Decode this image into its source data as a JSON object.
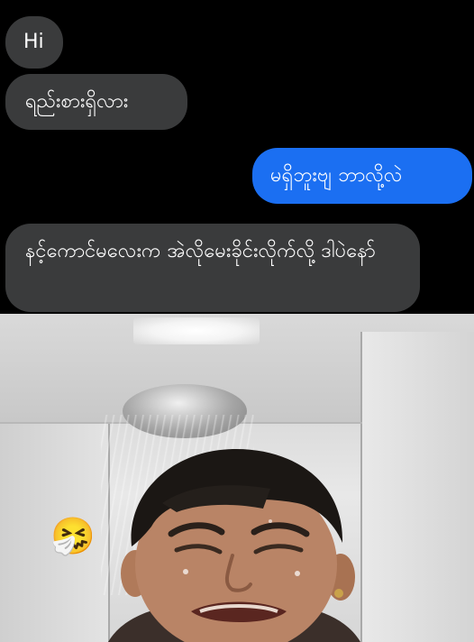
{
  "messages": [
    {
      "direction": "incoming",
      "text": "Hi"
    },
    {
      "direction": "incoming",
      "text": "ရည်းစားရှိလား"
    },
    {
      "direction": "outgoing",
      "text": "မရှိဘူးဗျ ဘာလို့လဲ"
    },
    {
      "direction": "incoming",
      "text": "နင့်ကောင်မလေးက အဲလိုမေးခိုင်းလိုက်လို့ ဒါပဲနော်"
    }
  ],
  "photo": {
    "emoji": "🤧",
    "emoji_icon": "sneezing-face-icon"
  },
  "colors": {
    "background": "#000000",
    "incoming_bubble": "#3a3b3c",
    "outgoing_bubble": "#1b6ff2",
    "text": "#ffffff"
  }
}
